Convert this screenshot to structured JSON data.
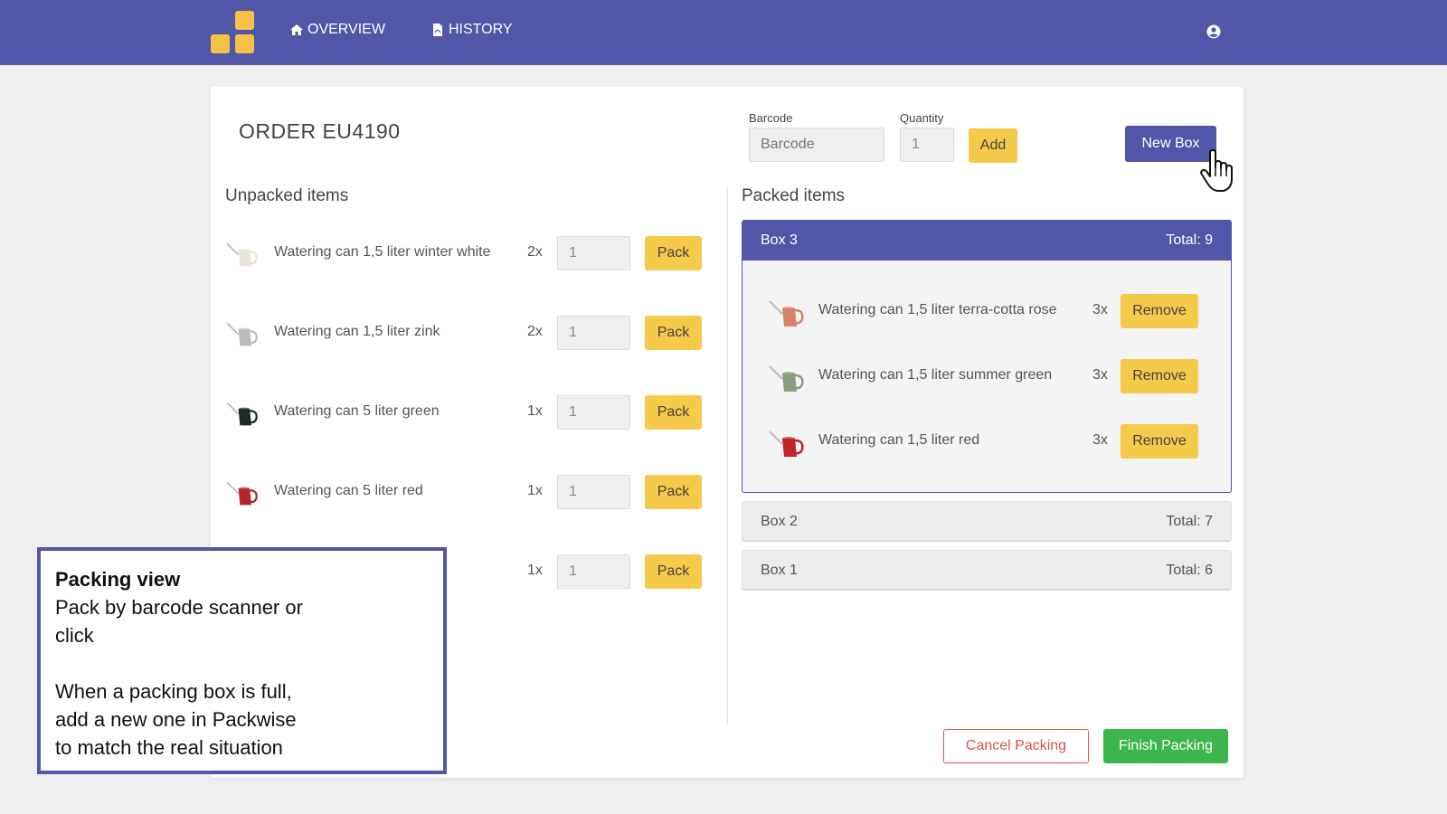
{
  "nav": {
    "overview_label": "OVERVIEW",
    "history_label": "HISTORY",
    "accent_color": "#5156a8",
    "logo_color": "#f5c246"
  },
  "order": {
    "title": "ORDER EU4190"
  },
  "scan": {
    "barcode_label": "Barcode",
    "barcode_placeholder": "Barcode",
    "quantity_label": "Quantity",
    "quantity_value": "1",
    "add_label": "Add",
    "new_box_label": "New Box"
  },
  "unpacked": {
    "title": "Unpacked items",
    "items": [
      {
        "name": "Watering can 1,5 liter winter white",
        "qty": "2x",
        "input": "1",
        "button": "Pack",
        "color": "#e8e4dc"
      },
      {
        "name": "Watering can 1,5 liter zink",
        "qty": "2x",
        "input": "1",
        "button": "Pack",
        "color": "#b9bcbf"
      },
      {
        "name": "Watering can 5 liter green",
        "qty": "1x",
        "input": "1",
        "button": "Pack",
        "color": "#1e2a24"
      },
      {
        "name": "Watering can 5 liter red",
        "qty": "1x",
        "input": "1",
        "button": "Pack",
        "color": "#b3252a"
      },
      {
        "name": "",
        "qty": "1x",
        "input": "1",
        "button": "Pack",
        "color": "#999999"
      }
    ]
  },
  "packed": {
    "title": "Packed items",
    "open_box": {
      "name": "Box 3",
      "total": "Total: 9",
      "items": [
        {
          "name": "Watering can 1,5 liter terra-cotta rose",
          "qty": "3x",
          "button": "Remove",
          "color": "#d9816b"
        },
        {
          "name": "Watering can 1,5 liter summer green",
          "qty": "3x",
          "button": "Remove",
          "color": "#8a9e7c"
        },
        {
          "name": "Watering can 1,5 liter red",
          "qty": "3x",
          "button": "Remove",
          "color": "#c3232b"
        }
      ]
    },
    "closed_boxes": [
      {
        "name": "Box 2",
        "total": "Total: 7"
      },
      {
        "name": "Box 1",
        "total": "Total: 6"
      }
    ]
  },
  "actions": {
    "cancel_label": "Cancel Packing",
    "finish_label": "Finish Packing",
    "cancel_color": "#d9534f",
    "finish_color": "#3cb64a"
  },
  "callout": {
    "title": "Packing view",
    "line1": "Pack by barcode scanner or",
    "line2": "click",
    "line3": "When a packing box is full,",
    "line4": "add a new one in Packwise",
    "line5": "to match the real situation"
  }
}
